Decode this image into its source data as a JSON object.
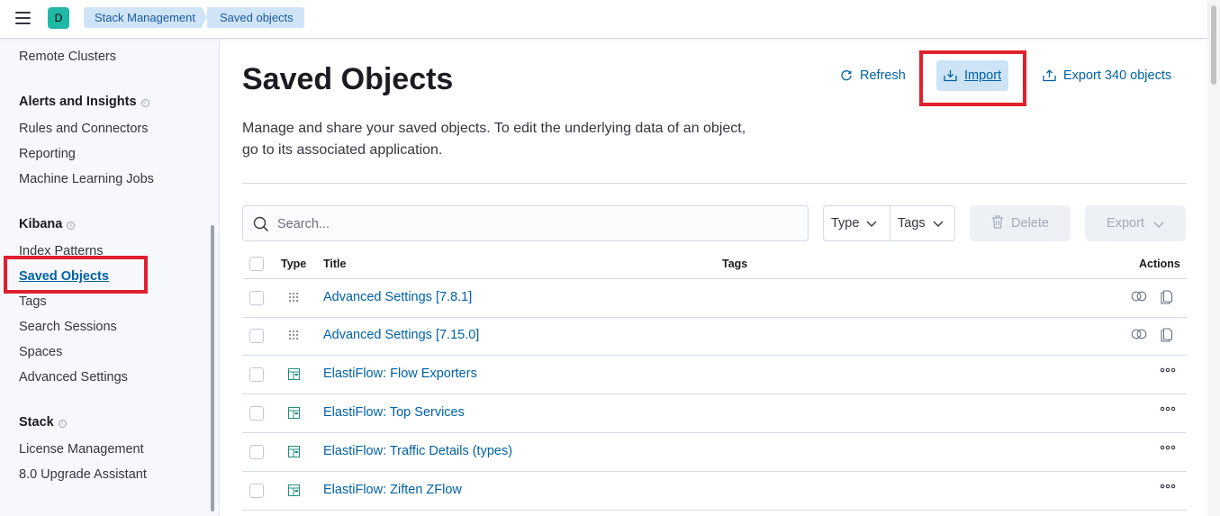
{
  "header": {
    "avatar_letter": "D",
    "breadcrumbs": [
      "Stack Management",
      "Saved objects"
    ]
  },
  "sidebar": {
    "items_top": [
      "Remote Clusters"
    ],
    "sections": [
      {
        "title": "Alerts and Insights",
        "items": [
          "Rules and Connectors",
          "Reporting",
          "Machine Learning Jobs"
        ]
      },
      {
        "title": "Kibana",
        "items": [
          "Index Patterns",
          "Saved Objects",
          "Tags",
          "Search Sessions",
          "Spaces",
          "Advanced Settings"
        ]
      },
      {
        "title": "Stack",
        "items": [
          "License Management",
          "8.0 Upgrade Assistant"
        ]
      }
    ],
    "active_item": "Saved Objects"
  },
  "page": {
    "title": "Saved Objects",
    "refresh_label": "Refresh",
    "import_label": "Import",
    "export_all_label": "Export 340 objects",
    "description": "Manage and share your saved objects. To edit the underlying data of an object, go to its associated application."
  },
  "toolbar": {
    "search_placeholder": "Search...",
    "type_filter": "Type",
    "tags_filter": "Tags",
    "delete_label": "Delete",
    "export_label": "Export"
  },
  "table": {
    "columns": [
      "Type",
      "Title",
      "Tags",
      "Actions"
    ],
    "rows": [
      {
        "type": "config",
        "title": "Advanced Settings [7.8.1]",
        "actions": "inspect-relationships"
      },
      {
        "type": "config",
        "title": "Advanced Settings [7.15.0]",
        "actions": "inspect-relationships"
      },
      {
        "type": "dashboard",
        "title": "ElastiFlow: Flow Exporters",
        "actions": "more"
      },
      {
        "type": "dashboard",
        "title": "ElastiFlow: Top Services",
        "actions": "more"
      },
      {
        "type": "dashboard",
        "title": "ElastiFlow: Traffic Details (types)",
        "actions": "more"
      },
      {
        "type": "dashboard",
        "title": "ElastiFlow: Ziften ZFlow",
        "actions": "more"
      }
    ]
  },
  "colors": {
    "link": "#0061a6",
    "highlight": "#e0202e",
    "avatar": "#20b8a6",
    "breadcrumb_bg": "#cfe4f7"
  }
}
